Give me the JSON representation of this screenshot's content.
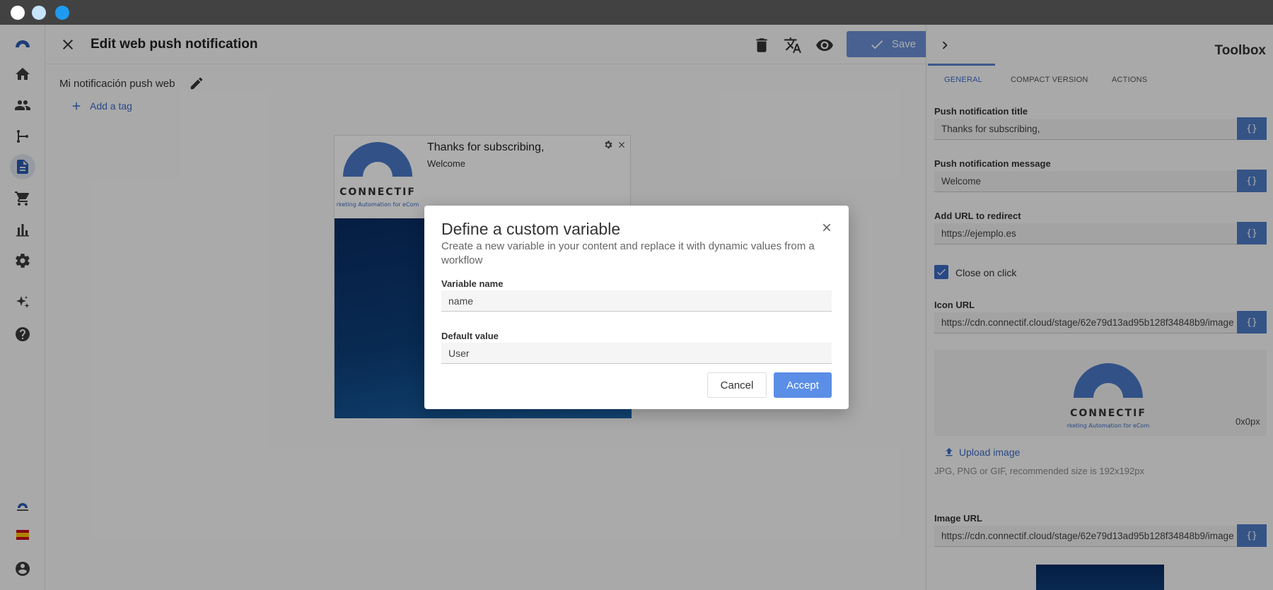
{
  "header": {
    "title": "Edit web push notification",
    "save_label": "Save"
  },
  "content": {
    "notification_name": "Mi notificación push web",
    "add_tag_label": "Add a tag"
  },
  "preview": {
    "title": "Thanks for subscribing,",
    "message": "Welcome",
    "logo_text": "CONNECTIF",
    "logo_tagline": "rketing Automation for eCom"
  },
  "toolbox": {
    "title": "Toolbox",
    "tabs": [
      "GENERAL",
      "COMPACT VERSION",
      "ACTIONS"
    ],
    "fields": {
      "push_title_label": "Push notification title",
      "push_title_value": "Thanks for subscribing,",
      "push_message_label": "Push notification message",
      "push_message_value": "Welcome",
      "redirect_label": "Add URL to redirect",
      "redirect_value": "https://ejemplo.es",
      "close_on_click_label": "Close on click",
      "icon_url_label": "Icon URL",
      "icon_url_value": "https://cdn.connectif.cloud/stage/62e79d13ad95b128f34848b9/image",
      "icon_size": "0x0px",
      "upload_label": "Upload image",
      "upload_hint": "JPG, PNG or GIF, recommended size is 192x192px",
      "image_url_label": "Image URL",
      "image_url_value": "https://cdn.connectif.cloud/stage/62e79d13ad95b128f34848b9/image"
    },
    "variable_button": "{}"
  },
  "dialog": {
    "title": "Define a custom variable",
    "subtitle": "Create a new variable in your content and replace it with dynamic values from a workflow",
    "variable_name_label": "Variable name",
    "variable_name_value": "name",
    "default_value_label": "Default value",
    "default_value_value": "User",
    "cancel_label": "Cancel",
    "accept_label": "Accept"
  },
  "colors": {
    "accent": "#3b6bc6",
    "primary_button": "#5b8ee6",
    "titlebar": "#424242"
  }
}
